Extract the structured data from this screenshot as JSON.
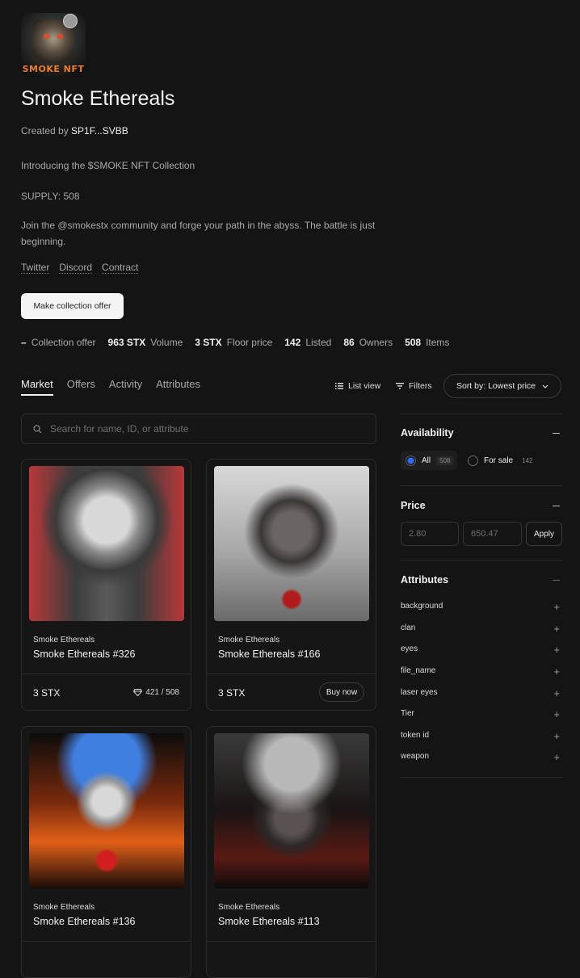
{
  "collection": {
    "logo_text": "SMOKE NFT",
    "title": "Smoke Ethereals",
    "created_by_label": "Created by",
    "creator": "SP1F...SVBB",
    "intro": "Introducing the $SMOKE NFT Collection",
    "supply": "SUPPLY: 508",
    "about": "Join the @smokestx community and forge your path in the abyss. The battle is just beginning.",
    "links": [
      "Twitter",
      "Discord",
      "Contract"
    ],
    "offer_button": "Make collection offer"
  },
  "stats": [
    {
      "value": "–",
      "label": "Collection offer"
    },
    {
      "value": "963 STX",
      "label": "Volume"
    },
    {
      "value": "3 STX",
      "label": "Floor price"
    },
    {
      "value": "142",
      "label": "Listed"
    },
    {
      "value": "86",
      "label": "Owners"
    },
    {
      "value": "508",
      "label": "Items"
    }
  ],
  "tabs": [
    "Market",
    "Offers",
    "Activity",
    "Attributes"
  ],
  "toolbar": {
    "list_view": "List view",
    "filters": "Filters",
    "sort": "Sort by: Lowest price"
  },
  "search": {
    "placeholder": "Search for name, ID, or attribute"
  },
  "cards": [
    {
      "collection": "Smoke Ethereals",
      "name": "Smoke Ethereals #326",
      "price": "3 STX",
      "rank": "421 / 508"
    },
    {
      "collection": "Smoke Ethereals",
      "name": "Smoke Ethereals #166",
      "price": "3 STX",
      "action": "Buy now"
    },
    {
      "collection": "Smoke Ethereals",
      "name": "Smoke Ethereals #136"
    },
    {
      "collection": "Smoke Ethereals",
      "name": "Smoke Ethereals #113"
    }
  ],
  "sidebar": {
    "availability": {
      "title": "Availability",
      "options": [
        {
          "label": "All",
          "count": "508",
          "selected": true
        },
        {
          "label": "For sale",
          "count": "142",
          "selected": false
        }
      ]
    },
    "price": {
      "title": "Price",
      "min": "2.80",
      "max": "650.47",
      "apply": "Apply"
    },
    "attributes": {
      "title": "Attributes",
      "items": [
        "background",
        "clan",
        "eyes",
        "file_name",
        "laser eyes",
        "Tier",
        "token id",
        "weapon"
      ]
    }
  },
  "colors": {
    "background": "#141414",
    "accent_blue": "#2f6bff",
    "text": "#f2f2f2",
    "muted": "#a9a9a9"
  }
}
